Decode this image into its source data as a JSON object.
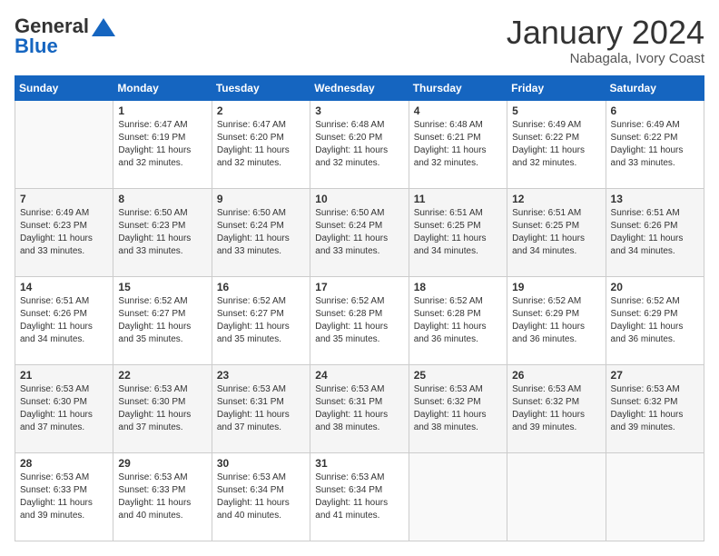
{
  "header": {
    "logo_general": "General",
    "logo_blue": "Blue",
    "month_title": "January 2024",
    "subtitle": "Nabagala, Ivory Coast"
  },
  "calendar": {
    "headers": [
      "Sunday",
      "Monday",
      "Tuesday",
      "Wednesday",
      "Thursday",
      "Friday",
      "Saturday"
    ],
    "weeks": [
      [
        {
          "day": "",
          "sunrise": "",
          "sunset": "",
          "daylight": ""
        },
        {
          "day": "1",
          "sunrise": "Sunrise: 6:47 AM",
          "sunset": "Sunset: 6:19 PM",
          "daylight": "Daylight: 11 hours and 32 minutes."
        },
        {
          "day": "2",
          "sunrise": "Sunrise: 6:47 AM",
          "sunset": "Sunset: 6:20 PM",
          "daylight": "Daylight: 11 hours and 32 minutes."
        },
        {
          "day": "3",
          "sunrise": "Sunrise: 6:48 AM",
          "sunset": "Sunset: 6:20 PM",
          "daylight": "Daylight: 11 hours and 32 minutes."
        },
        {
          "day": "4",
          "sunrise": "Sunrise: 6:48 AM",
          "sunset": "Sunset: 6:21 PM",
          "daylight": "Daylight: 11 hours and 32 minutes."
        },
        {
          "day": "5",
          "sunrise": "Sunrise: 6:49 AM",
          "sunset": "Sunset: 6:22 PM",
          "daylight": "Daylight: 11 hours and 32 minutes."
        },
        {
          "day": "6",
          "sunrise": "Sunrise: 6:49 AM",
          "sunset": "Sunset: 6:22 PM",
          "daylight": "Daylight: 11 hours and 33 minutes."
        }
      ],
      [
        {
          "day": "7",
          "sunrise": "Sunrise: 6:49 AM",
          "sunset": "Sunset: 6:23 PM",
          "daylight": "Daylight: 11 hours and 33 minutes."
        },
        {
          "day": "8",
          "sunrise": "Sunrise: 6:50 AM",
          "sunset": "Sunset: 6:23 PM",
          "daylight": "Daylight: 11 hours and 33 minutes."
        },
        {
          "day": "9",
          "sunrise": "Sunrise: 6:50 AM",
          "sunset": "Sunset: 6:24 PM",
          "daylight": "Daylight: 11 hours and 33 minutes."
        },
        {
          "day": "10",
          "sunrise": "Sunrise: 6:50 AM",
          "sunset": "Sunset: 6:24 PM",
          "daylight": "Daylight: 11 hours and 33 minutes."
        },
        {
          "day": "11",
          "sunrise": "Sunrise: 6:51 AM",
          "sunset": "Sunset: 6:25 PM",
          "daylight": "Daylight: 11 hours and 34 minutes."
        },
        {
          "day": "12",
          "sunrise": "Sunrise: 6:51 AM",
          "sunset": "Sunset: 6:25 PM",
          "daylight": "Daylight: 11 hours and 34 minutes."
        },
        {
          "day": "13",
          "sunrise": "Sunrise: 6:51 AM",
          "sunset": "Sunset: 6:26 PM",
          "daylight": "Daylight: 11 hours and 34 minutes."
        }
      ],
      [
        {
          "day": "14",
          "sunrise": "Sunrise: 6:51 AM",
          "sunset": "Sunset: 6:26 PM",
          "daylight": "Daylight: 11 hours and 34 minutes."
        },
        {
          "day": "15",
          "sunrise": "Sunrise: 6:52 AM",
          "sunset": "Sunset: 6:27 PM",
          "daylight": "Daylight: 11 hours and 35 minutes."
        },
        {
          "day": "16",
          "sunrise": "Sunrise: 6:52 AM",
          "sunset": "Sunset: 6:27 PM",
          "daylight": "Daylight: 11 hours and 35 minutes."
        },
        {
          "day": "17",
          "sunrise": "Sunrise: 6:52 AM",
          "sunset": "Sunset: 6:28 PM",
          "daylight": "Daylight: 11 hours and 35 minutes."
        },
        {
          "day": "18",
          "sunrise": "Sunrise: 6:52 AM",
          "sunset": "Sunset: 6:28 PM",
          "daylight": "Daylight: 11 hours and 36 minutes."
        },
        {
          "day": "19",
          "sunrise": "Sunrise: 6:52 AM",
          "sunset": "Sunset: 6:29 PM",
          "daylight": "Daylight: 11 hours and 36 minutes."
        },
        {
          "day": "20",
          "sunrise": "Sunrise: 6:52 AM",
          "sunset": "Sunset: 6:29 PM",
          "daylight": "Daylight: 11 hours and 36 minutes."
        }
      ],
      [
        {
          "day": "21",
          "sunrise": "Sunrise: 6:53 AM",
          "sunset": "Sunset: 6:30 PM",
          "daylight": "Daylight: 11 hours and 37 minutes."
        },
        {
          "day": "22",
          "sunrise": "Sunrise: 6:53 AM",
          "sunset": "Sunset: 6:30 PM",
          "daylight": "Daylight: 11 hours and 37 minutes."
        },
        {
          "day": "23",
          "sunrise": "Sunrise: 6:53 AM",
          "sunset": "Sunset: 6:31 PM",
          "daylight": "Daylight: 11 hours and 37 minutes."
        },
        {
          "day": "24",
          "sunrise": "Sunrise: 6:53 AM",
          "sunset": "Sunset: 6:31 PM",
          "daylight": "Daylight: 11 hours and 38 minutes."
        },
        {
          "day": "25",
          "sunrise": "Sunrise: 6:53 AM",
          "sunset": "Sunset: 6:32 PM",
          "daylight": "Daylight: 11 hours and 38 minutes."
        },
        {
          "day": "26",
          "sunrise": "Sunrise: 6:53 AM",
          "sunset": "Sunset: 6:32 PM",
          "daylight": "Daylight: 11 hours and 39 minutes."
        },
        {
          "day": "27",
          "sunrise": "Sunrise: 6:53 AM",
          "sunset": "Sunset: 6:32 PM",
          "daylight": "Daylight: 11 hours and 39 minutes."
        }
      ],
      [
        {
          "day": "28",
          "sunrise": "Sunrise: 6:53 AM",
          "sunset": "Sunset: 6:33 PM",
          "daylight": "Daylight: 11 hours and 39 minutes."
        },
        {
          "day": "29",
          "sunrise": "Sunrise: 6:53 AM",
          "sunset": "Sunset: 6:33 PM",
          "daylight": "Daylight: 11 hours and 40 minutes."
        },
        {
          "day": "30",
          "sunrise": "Sunrise: 6:53 AM",
          "sunset": "Sunset: 6:34 PM",
          "daylight": "Daylight: 11 hours and 40 minutes."
        },
        {
          "day": "31",
          "sunrise": "Sunrise: 6:53 AM",
          "sunset": "Sunset: 6:34 PM",
          "daylight": "Daylight: 11 hours and 41 minutes."
        },
        {
          "day": "",
          "sunrise": "",
          "sunset": "",
          "daylight": ""
        },
        {
          "day": "",
          "sunrise": "",
          "sunset": "",
          "daylight": ""
        },
        {
          "day": "",
          "sunrise": "",
          "sunset": "",
          "daylight": ""
        }
      ]
    ]
  }
}
